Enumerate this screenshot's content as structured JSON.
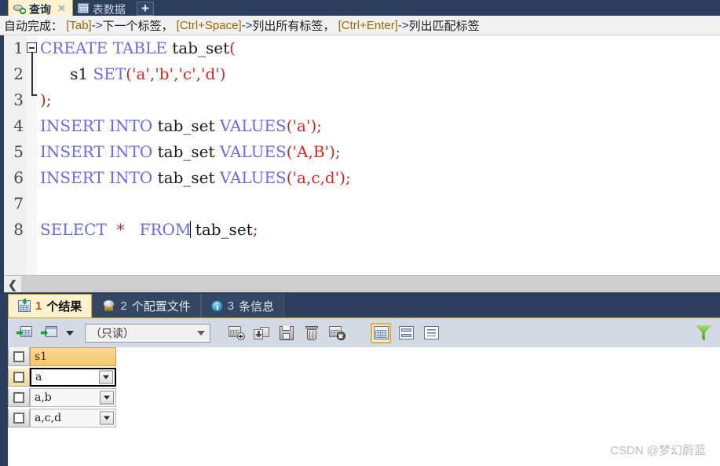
{
  "window": {
    "top_tabs": [
      {
        "label": "查询",
        "icon": "query-icon",
        "active": true,
        "closable": true
      },
      {
        "label": "表数据",
        "icon": "table-grid-icon",
        "active": false,
        "closable": false
      }
    ],
    "new_tab_label": "+"
  },
  "hint_bar": {
    "prefix": "自动完成：",
    "items": [
      {
        "key": "[Tab]",
        "arrow": "->",
        "text": " 下一个标签，"
      },
      {
        "key": "[Ctrl+Space]",
        "arrow": "->",
        "text": " 列出所有标签，"
      },
      {
        "key": "[Ctrl+Enter]",
        "arrow": "->",
        "text": " 列出匹配标签"
      }
    ]
  },
  "editor": {
    "line_numbers": [
      "1",
      "2",
      "3",
      "4",
      "5",
      "6",
      "7",
      "8"
    ],
    "lines": [
      {
        "n": 1,
        "text": "CREATE TABLE tab_set("
      },
      {
        "n": 2,
        "text": "       s1 SET('a','b','c','d')"
      },
      {
        "n": 3,
        "text": ");"
      },
      {
        "n": 4,
        "text": "INSERT INTO tab_set VALUES('a');"
      },
      {
        "n": 5,
        "text": "INSERT INTO tab_set VALUES('A,B');"
      },
      {
        "n": 6,
        "text": "INSERT INTO tab_set VALUES('a,c,d');"
      },
      {
        "n": 7,
        "text": ""
      },
      {
        "n": 8,
        "text": "SELECT  *   FROM tab_set;"
      }
    ],
    "tokens": {
      "l1_kw1": "CREATE",
      "l1_kw2": "TABLE",
      "l1_id": "tab_set",
      "l1_p": "(",
      "l2_id": "s1",
      "l2_kw": "SET",
      "l2_p1": "(",
      "l2_s1": "'a'",
      "l2_c1": ",",
      "l2_s2": "'b'",
      "l2_c2": ",",
      "l2_s3": "'c'",
      "l2_c3": ",",
      "l2_s4": "'d'",
      "l2_p2": ")",
      "l3_p": ");",
      "l4_kw1": "INSERT",
      "l4_kw2": "INTO",
      "l4_id": "tab_set",
      "l4_kw3": "VALUES",
      "l4_p1": "(",
      "l4_s": "'a'",
      "l4_p2": ");",
      "l5_kw1": "INSERT",
      "l5_kw2": "INTO",
      "l5_id": "tab_set",
      "l5_kw3": "VALUES",
      "l5_p1": "(",
      "l5_s": "'A,B'",
      "l5_p2": ");",
      "l6_kw1": "INSERT",
      "l6_kw2": "INTO",
      "l6_id": "tab_set",
      "l6_kw3": "VALUES",
      "l6_p1": "(",
      "l6_s": "'a,c,d'",
      "l6_p2": ");",
      "l8_kw1": "SELECT",
      "l8_ast": "*",
      "l8_kw2": "FROM",
      "l8_id": "tab_set",
      "l8_p": ";"
    },
    "fold_marker": "−",
    "scrollbar_left_arrow": "❮"
  },
  "results_panel": {
    "tabs": [
      {
        "num": "1",
        "label": "个结果",
        "icon": "result-grid-icon",
        "active": true
      },
      {
        "num": "2",
        "label": "个配置文件",
        "icon": "profile-icon",
        "active": false
      },
      {
        "num": "3",
        "label": "条信息",
        "icon": "info-icon",
        "active": false
      }
    ],
    "toolbar": {
      "buttons": [
        {
          "name": "insert-row-button",
          "icon": "grid-green-arrow-icon"
        },
        {
          "name": "insert-row-menu-button",
          "icon": "grid-window-green-arrow-icon"
        },
        {
          "name": "toolbar-dropdown-caret",
          "icon": "chevron-down-icon"
        }
      ],
      "mode_select_value": "（只读）",
      "action_buttons": [
        {
          "name": "add-record-button",
          "icon": "grid-plus-icon"
        },
        {
          "name": "revert-record-button",
          "icon": "revert-arrow-icon"
        },
        {
          "name": "save-record-button",
          "icon": "floppy-save-icon"
        },
        {
          "name": "delete-record-button",
          "icon": "trash-icon"
        },
        {
          "name": "discard-changes-button",
          "icon": "grid-cross-icon"
        }
      ],
      "view_buttons": [
        {
          "name": "grid-view-button",
          "icon": "view-grid-icon",
          "selected": true
        },
        {
          "name": "form-view-button",
          "icon": "view-form-icon",
          "selected": false
        },
        {
          "name": "text-view-button",
          "icon": "view-text-icon",
          "selected": false
        }
      ],
      "filter_button": {
        "name": "filter-button",
        "icon": "funnel-icon"
      }
    },
    "grid": {
      "columns": [
        "s1"
      ],
      "rows": [
        {
          "cells": [
            "a"
          ],
          "selected": true
        },
        {
          "cells": [
            "a,b"
          ],
          "selected": false
        },
        {
          "cells": [
            "a,c,d"
          ],
          "selected": false
        }
      ]
    }
  },
  "watermark": "CSDN @梦幻蔚蓝",
  "colors": {
    "chrome_dark": "#2b3e5c",
    "tab_active": "#fdf2cf",
    "tab_accent": "#c9a227",
    "panel_bg": "#d3dae3",
    "keyword": "#6b6bdb",
    "string": "#dc2626",
    "punct": "#b03030",
    "header_cell": "#f6c86c",
    "green": "#2f8f12"
  }
}
